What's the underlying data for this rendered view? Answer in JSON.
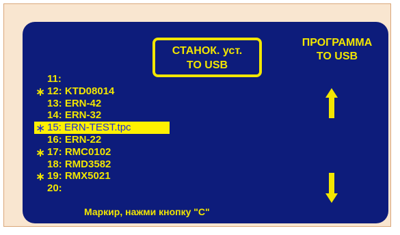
{
  "header": {
    "machine_box_line1": "СТАНОК. уст.",
    "machine_box_line2": "TO USB",
    "program_line1": "ПРОГРАММА",
    "program_line2": "TO USB"
  },
  "programs": [
    {
      "marker": "",
      "label": "11:"
    },
    {
      "marker": "∗",
      "label": "12: KTD08014"
    },
    {
      "marker": "",
      "label": "13: ERN-42"
    },
    {
      "marker": "",
      "label": "14: ERN-32"
    },
    {
      "marker": "∗",
      "label": "15: ERN-TEST.tpc"
    },
    {
      "marker": "",
      "label": "16: ERN-22"
    },
    {
      "marker": "∗",
      "label": "17: RMC0102"
    },
    {
      "marker": "",
      "label": "18: RMD3582"
    },
    {
      "marker": "∗",
      "label": "19: RMX5021"
    },
    {
      "marker": "",
      "label": "20:"
    }
  ],
  "selected_index": 4,
  "footer": {
    "hint": "Маркир,  нажми кнопку \"C\""
  },
  "icons": {
    "scroll_up": "arrow-up-icon",
    "scroll_down": "arrow-down-icon",
    "marker": "asterisk-marker-icon"
  },
  "colors": {
    "background_frame": "#f9e6d0",
    "screen": "#0d1c7b",
    "text": "#f2e600",
    "selection_bg": "#fff100",
    "selection_text": "#1a2cd9"
  }
}
